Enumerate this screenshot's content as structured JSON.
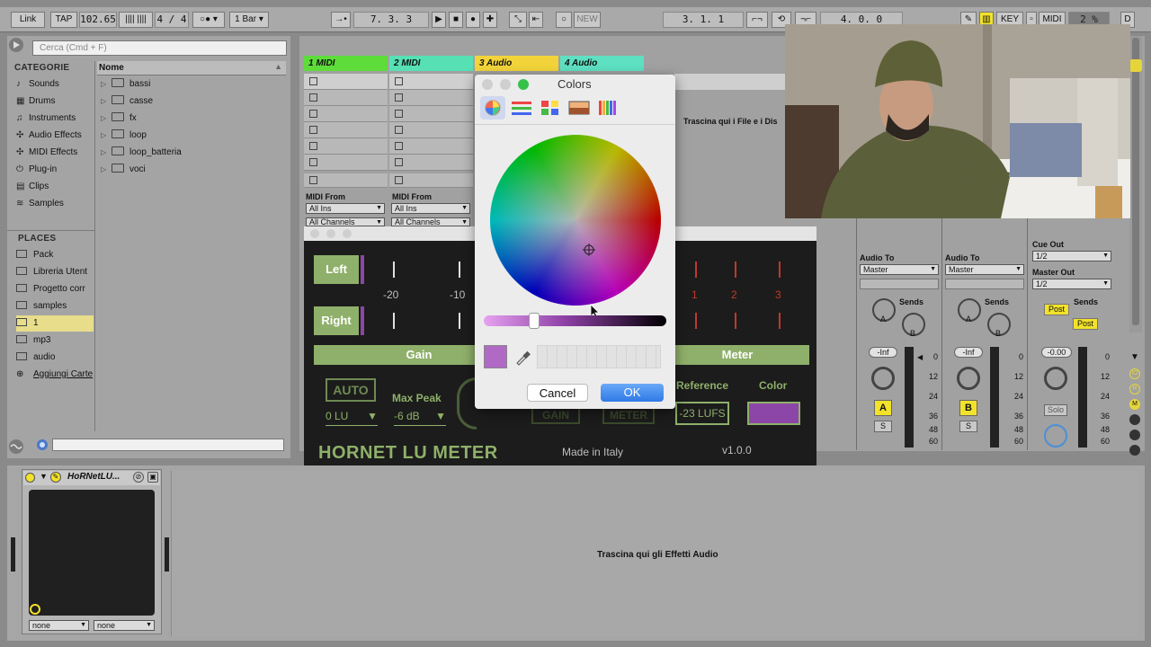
{
  "transport": {
    "link": "Link",
    "tap": "TAP",
    "tempo": "102.65",
    "sig": "4 / 4",
    "quant": "1 Bar",
    "position": "7.   3.   3",
    "new": "NEW",
    "loop_start": "3.   1.   1",
    "loop_len": "4.   0.   0",
    "key": "KEY",
    "midi": "MIDI",
    "cpu": "2 %",
    "d": "D"
  },
  "browser": {
    "search_placeholder": "Cerca (Cmd + F)",
    "categories_title": "CATEGORIE",
    "name_header": "Nome",
    "categories": [
      {
        "label": "Sounds",
        "icon": "♪"
      },
      {
        "label": "Drums",
        "icon": "▦"
      },
      {
        "label": "Instruments",
        "icon": "♫"
      },
      {
        "label": "Audio Effects",
        "icon": "✣"
      },
      {
        "label": "MIDI Effects",
        "icon": "✣"
      },
      {
        "label": "Plug-in",
        "icon": "⏻"
      },
      {
        "label": "Clips",
        "icon": "▤"
      },
      {
        "label": "Samples",
        "icon": "≋"
      }
    ],
    "folders": [
      "bassi",
      "casse",
      "fx",
      "loop",
      "loop_batteria",
      "voci"
    ],
    "places_title": "PLACES",
    "places": [
      "Pack",
      "Libreria Utent",
      "Progetto corr",
      "samples",
      "1",
      "mp3",
      "audio",
      "Aggiungi Carte"
    ]
  },
  "session": {
    "tracks": [
      {
        "name": "1 MIDI",
        "color": "#5ddc3a"
      },
      {
        "name": "2 MIDI",
        "color": "#56e0b4"
      },
      {
        "name": "3 Audio",
        "color": "#f2d43a"
      },
      {
        "name": "4 Audio",
        "color": "#5ee0c2"
      }
    ],
    "drop_files": "Trascina qui i File e i Dis",
    "midi_from": "MIDI From",
    "all_ins": "All Ins",
    "all_channels": "All Channels",
    "audio_to": "Audio To",
    "master": "Master",
    "cue_out": "Cue Out",
    "cue_val": "1/2",
    "master_out": "Master Out",
    "master_val": "1/2",
    "sends": "Sends",
    "post": "Post",
    "inf": "-Inf",
    "vol_master": "-0.00",
    "a": "A",
    "b": "B",
    "s": "S",
    "solo": "Solo",
    "scale": [
      "0",
      "12",
      "24",
      "36",
      "48",
      "60"
    ],
    "knob_a": "A",
    "knob_b": "B"
  },
  "plugin": {
    "left": "Left",
    "right": "Right",
    "tick_n20": "-20",
    "tick_n10": "-10",
    "tick_1": "1",
    "tick_2": "2",
    "tick_3": "3",
    "gain": "Gain",
    "meter": "Meter",
    "auto": "AUTO",
    "max_peak": "Max Peak",
    "lu_val": "0 LU",
    "db_val": "-6 dB",
    "reference": "Reference",
    "ref_val": "-23 LUFS",
    "color": "Color",
    "color_swatch": "#8b46a8",
    "gain_btn": "GAIN",
    "meter_btn": "METER",
    "title": "HORNET LU METER",
    "made": "Made in Italy",
    "version": "v1.0.0"
  },
  "colors_dialog": {
    "title": "Colors",
    "cancel": "Cancel",
    "ok": "OK",
    "current_color": "#b06ac6"
  },
  "device": {
    "name": "HoRNetLU...",
    "drop_effects": "Trascina qui gli Effetti Audio",
    "none1": "none",
    "none2": "none"
  }
}
